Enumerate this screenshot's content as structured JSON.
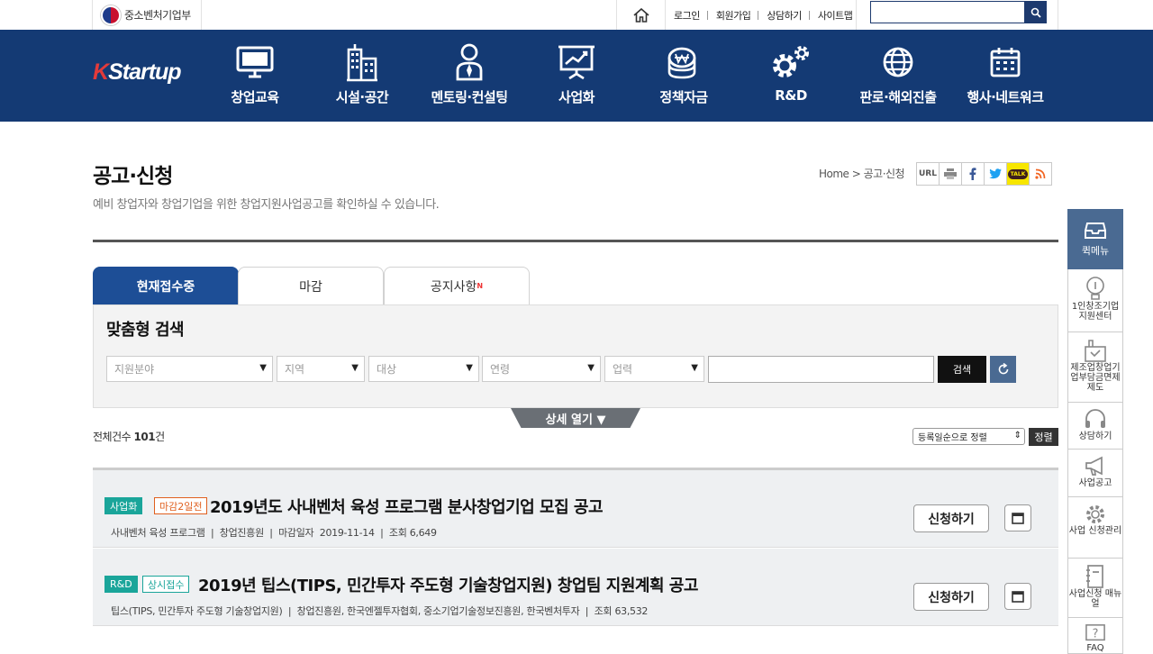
{
  "header": {
    "ministry": "중소벤처기업부",
    "links": [
      "로그인",
      "회원가입",
      "상담하기",
      "사이트맵"
    ],
    "search_placeholder": ""
  },
  "gnb": {
    "logo_k": "K",
    "logo_rest": "Startup",
    "menus": [
      {
        "label": "창업교육",
        "icon": "monitor-icon"
      },
      {
        "label": "시설·공간",
        "icon": "building-icon"
      },
      {
        "label": "멘토링·컨설팅",
        "icon": "person-icon"
      },
      {
        "label": "사업화",
        "icon": "presentation-chart-icon"
      },
      {
        "label": "정책자금",
        "icon": "coins-icon"
      },
      {
        "label": "R&D",
        "icon": "gears-icon"
      },
      {
        "label": "판로·해외진출",
        "icon": "globe-icon"
      },
      {
        "label": "행사·네트워크",
        "icon": "calendar-icon"
      }
    ]
  },
  "page": {
    "title": "공고·신청",
    "desc": "예비 창업자와 창업기업을 위한 창업지원사업공고를 확인하실 수 있습니다.",
    "breadcrumb": "Home > 공고·신청",
    "share": [
      "URL",
      "print-icon",
      "facebook-icon",
      "twitter-icon",
      "kakaotalk-icon",
      "rss-icon"
    ]
  },
  "tabs": [
    {
      "label": "현재접수중",
      "active": true
    },
    {
      "label": "마감",
      "active": false
    },
    {
      "label": "공지사항",
      "active": false,
      "badge": "N"
    }
  ],
  "search": {
    "title": "맞춤형 검색",
    "selects": [
      "지원분야",
      "지역",
      "대상",
      "연령",
      "업력"
    ],
    "keyword": "",
    "search_btn": "검색",
    "detail_btn": "상세 열기 ▼"
  },
  "list": {
    "total_label": "전체건수",
    "total": "101",
    "total_unit": "건",
    "sort_value": "등록일순으로 정렬",
    "sort_btn": "정렬",
    "items": [
      {
        "category": "사업화",
        "badge": "마감2일전",
        "title": "2019년도 사내벤처 육성 프로그램 분사창업기업 모집 공고",
        "meta": "사내벤처 육성 프로그램  |  창업진흥원  |  마감일자  2019-11-14  |  조회 6,649",
        "apply": "신청하기"
      },
      {
        "category": "R&D",
        "badge": "상시접수",
        "title": "2019년 팁스(TIPS, 민간투자 주도형 기술창업지원) 창업팀 지원계획 공고",
        "meta": "팁스(TIPS, 민간투자 주도형 기술창업지원)  |  창업진흥원, 한국엔젤투자협회, 중소기업기술정보진흥원, 한국벤처투자  |  조회 63,532",
        "apply": "신청하기"
      }
    ]
  },
  "quick": {
    "head": "퀵메뉴",
    "items": [
      {
        "label": "1인창조기업 지원센터",
        "icon": "lightbulb-icon"
      },
      {
        "label": "제조업창업기 업부담금면제 제도",
        "icon": "factory-icon"
      },
      {
        "label": "상담하기",
        "icon": "headset-icon"
      },
      {
        "label": "사업공고",
        "icon": "megaphone-icon"
      },
      {
        "label": "사업 신청관리",
        "icon": "gear-icon"
      },
      {
        "label": "사업신청 매뉴얼",
        "icon": "manual-icon"
      },
      {
        "label": "FAQ",
        "icon": "question-icon"
      }
    ]
  }
}
